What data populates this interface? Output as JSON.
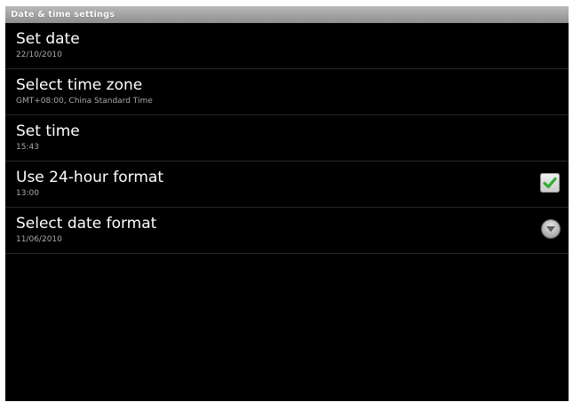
{
  "window": {
    "title": "Date & time settings"
  },
  "settings": {
    "items": [
      {
        "title": "Set date",
        "summary": "22/10/2010"
      },
      {
        "title": "Select time zone",
        "summary": "GMT+08:00, China Standard Time"
      },
      {
        "title": "Set time",
        "summary": "15:43"
      },
      {
        "title": "Use 24-hour format",
        "summary": "13:00",
        "control": "checkbox",
        "checked": true
      },
      {
        "title": "Select date format",
        "summary": "11/06/2010",
        "control": "dropdown"
      }
    ]
  },
  "colors": {
    "background": "#000000",
    "titlebar": "#9e9e9e",
    "check_green": "#2fae2f"
  },
  "icons": {
    "checkbox": "checkmark-icon",
    "dropdown": "chevron-down-icon"
  }
}
